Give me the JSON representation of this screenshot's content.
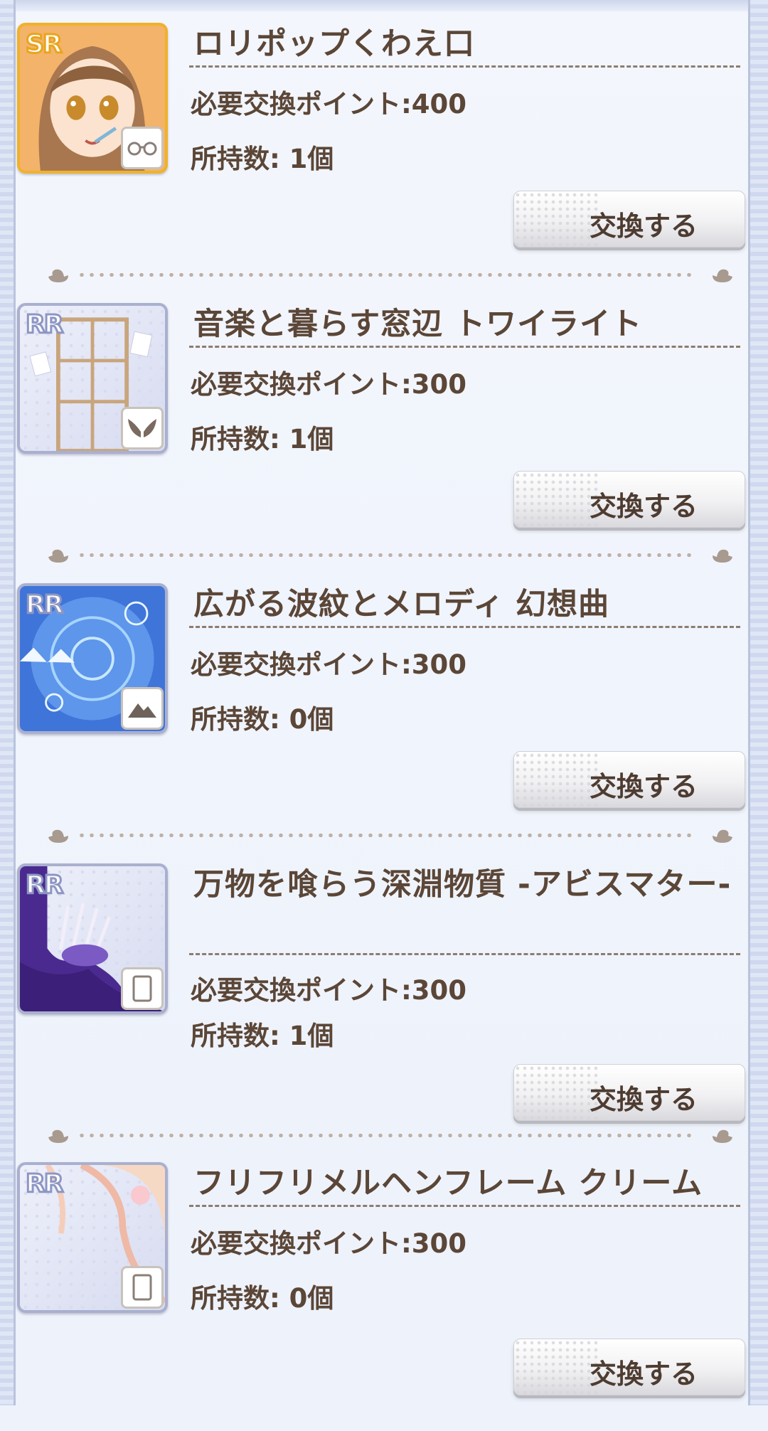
{
  "labels": {
    "points_prefix": "必要交換ポイント:",
    "owned_prefix": "所持数: ",
    "exchange_button": "交換する"
  },
  "items": [
    {
      "rarity": "SR",
      "name": "ロリポップくわえ口",
      "points": "必要交換ポイント:400",
      "owned": "所持数: 1個",
      "button": "交換する",
      "type_icon": "glasses-icon"
    },
    {
      "rarity": "RR",
      "name": "音楽と暮らす窓辺 トワイライト",
      "points": "必要交換ポイント:300",
      "owned": "所持数: 1個",
      "button": "交換する",
      "type_icon": "wings-icon"
    },
    {
      "rarity": "RR",
      "name": "広がる波紋とメロディ 幻想曲",
      "points": "必要交換ポイント:300",
      "owned": "所持数: 0個",
      "button": "交換する",
      "type_icon": "mountain-icon"
    },
    {
      "rarity": "RR",
      "name": "万物を喰らう深淵物質 -アビスマター-",
      "points": "必要交換ポイント:300",
      "owned": "所持数: 1個",
      "button": "交換する",
      "type_icon": "frame-icon"
    },
    {
      "rarity": "RR",
      "name": "フリフリメルヘンフレーム クリーム",
      "points": "必要交換ポイント:300",
      "owned": "所持数: 0個",
      "button": "交換する",
      "type_icon": "frame-icon"
    }
  ]
}
